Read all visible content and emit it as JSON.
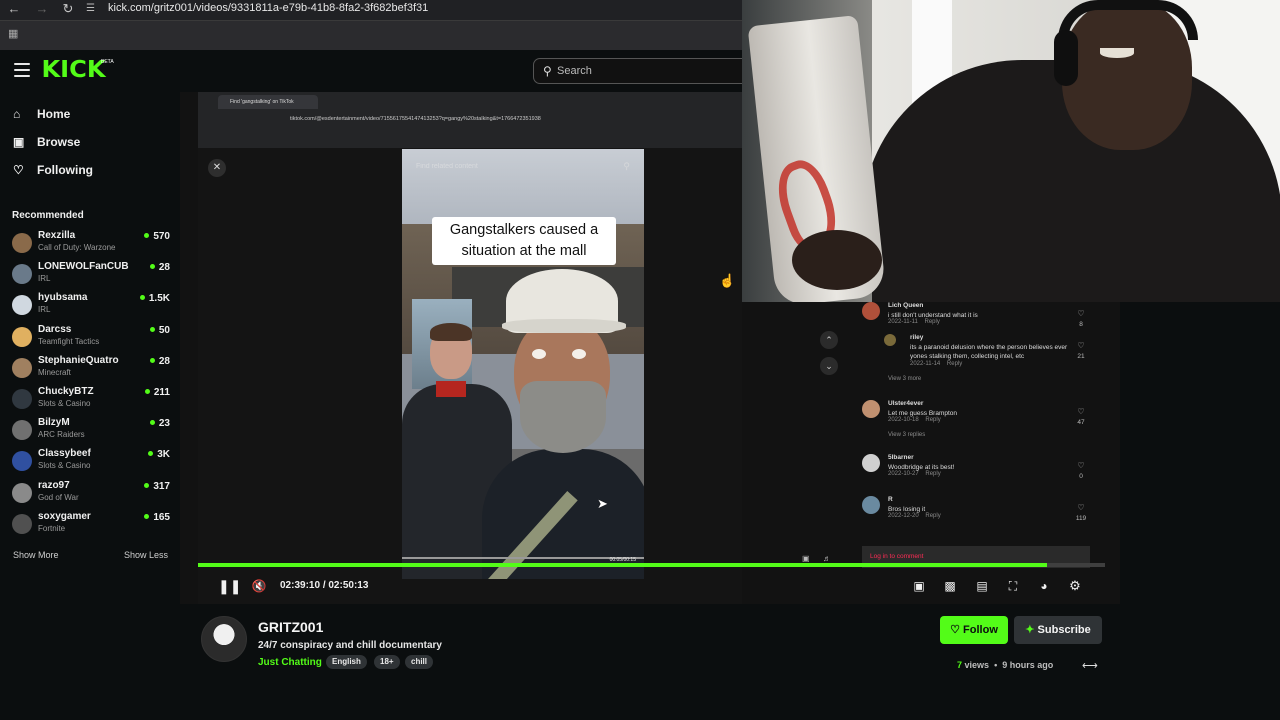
{
  "browser": {
    "url": "kick.com/gritz001/videos/9331811a-e79b-41b8-8fa2-3f682bef3f31"
  },
  "header": {
    "logo": "KICK",
    "logo_badge": "BETA",
    "search_placeholder": "Search"
  },
  "sidebar": {
    "nav": [
      {
        "label": "Home",
        "icon": "home-icon"
      },
      {
        "label": "Browse",
        "icon": "browse-icon"
      },
      {
        "label": "Following",
        "icon": "heart-icon"
      }
    ],
    "recommended_title": "Recommended",
    "channels": [
      {
        "name": "Rexzilla",
        "category": "Call of Duty: Warzone",
        "viewers": "570",
        "color": "#8a6a4a"
      },
      {
        "name": "LONEWOLFanCUB",
        "category": "IRL",
        "viewers": "28",
        "color": "#6a7a8a"
      },
      {
        "name": "hyubsama",
        "category": "IRL",
        "viewers": "1.5K",
        "color": "#d0d8e0"
      },
      {
        "name": "Darcss",
        "category": "Teamfight Tactics",
        "viewers": "50",
        "color": "#e0b060"
      },
      {
        "name": "StephanieQuatro",
        "category": "Minecraft",
        "viewers": "28",
        "color": "#a08060"
      },
      {
        "name": "ChuckyBTZ",
        "category": "Slots & Casino",
        "viewers": "211",
        "color": "#303840"
      },
      {
        "name": "BilzyM",
        "category": "ARC Raiders",
        "viewers": "23",
        "color": "#707070"
      },
      {
        "name": "Classybeef",
        "category": "Slots & Casino",
        "viewers": "3K",
        "color": "#3050a0"
      },
      {
        "name": "razo97",
        "category": "God of War",
        "viewers": "317",
        "color": "#8a8a8a"
      },
      {
        "name": "soxygamer",
        "category": "Fortnite",
        "viewers": "165",
        "color": "#505050"
      }
    ],
    "show_more": "Show More",
    "show_less": "Show Less"
  },
  "inner_browser": {
    "tab_title": "Find 'gangstalking' on TikTok",
    "url": "tiktok.com/@esdentertainment/video/7155617554147413253?q=gangy%20stalking&t=1766472351938"
  },
  "tiktok": {
    "related": "Find related content",
    "caption": "Gangstalkers caused  a situation at the mall",
    "time": "00:05/00:15",
    "comments": [
      {
        "user": "Lich Queen",
        "text": "i still don't understand what it is",
        "date": "2022-11-11",
        "reply": "Reply",
        "likes": "8",
        "color": "#b0503a"
      },
      {
        "user": "riley",
        "text": "its a paranoid delusion where the person believes ever yones stalking them, collecting intel, etc",
        "date": "2022-11-14",
        "reply": "Reply",
        "likes": "21",
        "color": "#7a6a3a"
      },
      {
        "user": "Ulster4ever",
        "text": "Let me guess Brampton",
        "date": "2022-10-18",
        "reply": "Reply",
        "likes": "47",
        "color": "#c09070"
      },
      {
        "user": "5lbarner",
        "text": "Woodbridge at its best!",
        "date": "2022-10-27",
        "reply": "Reply",
        "likes": "0",
        "color": "#d0d0d0"
      },
      {
        "user": "R",
        "text": "Bros losing it",
        "date": "2022-12-20",
        "reply": "Reply",
        "likes": "119",
        "color": "#6a8aa0"
      }
    ],
    "view_more_1": "View 3 more",
    "view_more_2": "View 3 replies",
    "login": "Log in to comment"
  },
  "player": {
    "current": "02:39:10",
    "total": "02:50:13",
    "separator": "/",
    "progress": 0.936
  },
  "channel": {
    "name": "GRITZ001",
    "title": "24/7 conspiracy and chill documentary",
    "category": "Just Chatting",
    "tags": [
      "English",
      "18+",
      "chill"
    ],
    "follow": "Follow",
    "subscribe": "Subscribe",
    "views": "7",
    "views_label": "views",
    "ago": "9 hours ago"
  },
  "colors": {
    "accent": "#53fc18",
    "background": "#0b0e0f",
    "tiktok_red": "#fe2c55"
  }
}
